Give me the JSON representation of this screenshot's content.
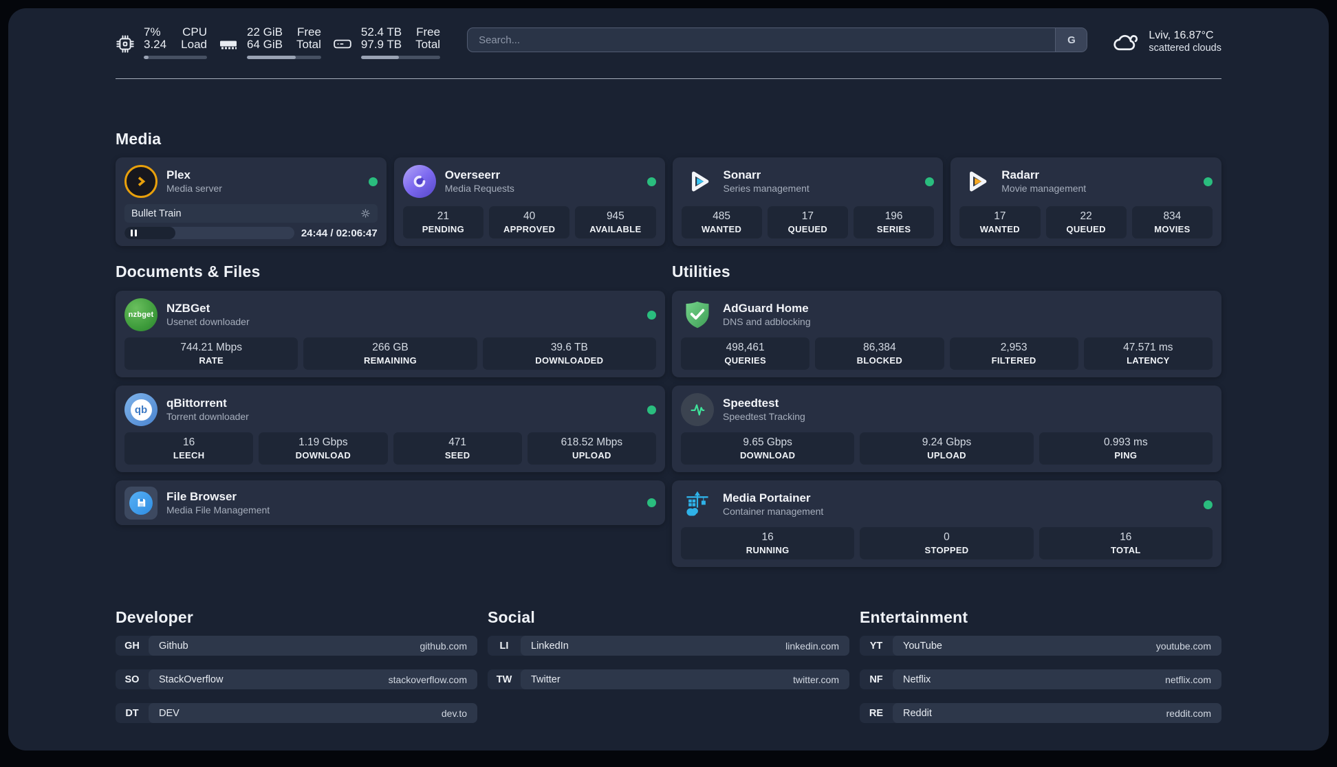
{
  "app": {
    "topbar": {
      "cpu": {
        "value_top": "7%",
        "value_bottom": "3.24",
        "label_top": "CPU",
        "label_bottom": "Load",
        "bar_percent": 8
      },
      "memory": {
        "value_top": "22 GiB",
        "value_bottom": "64 GiB",
        "label_top": "Free",
        "label_bottom": "Total",
        "bar_percent": 66
      },
      "storage": {
        "value_top": "52.4 TB",
        "value_bottom": "97.9 TB",
        "label_top": "Free",
        "label_bottom": "Total",
        "bar_percent": 48
      },
      "search": {
        "placeholder": "Search...",
        "button_label": "G"
      },
      "weather": {
        "location": "Lviv, 16.87°C",
        "condition": "scattered clouds"
      }
    },
    "sections": {
      "media": {
        "title": "Media",
        "apps": [
          {
            "name": "Plex",
            "description": "Media server",
            "online": true,
            "icon": "plex-icon",
            "player": {
              "title": "Bullet Train",
              "time": "24:44 / 02:06:47",
              "progress_percent": 30
            }
          },
          {
            "name": "Overseerr",
            "description": "Media Requests",
            "online": true,
            "icon": "overseerr-icon",
            "stats": [
              {
                "value": "21",
                "label": "PENDING"
              },
              {
                "value": "40",
                "label": "APPROVED"
              },
              {
                "value": "945",
                "label": "AVAILABLE"
              }
            ]
          },
          {
            "name": "Sonarr",
            "description": "Series management",
            "online": true,
            "icon": "sonarr-icon",
            "stats": [
              {
                "value": "485",
                "label": "WANTED"
              },
              {
                "value": "17",
                "label": "QUEUED"
              },
              {
                "value": "196",
                "label": "SERIES"
              }
            ]
          },
          {
            "name": "Radarr",
            "description": "Movie management",
            "online": true,
            "icon": "radarr-icon",
            "stats": [
              {
                "value": "17",
                "label": "WANTED"
              },
              {
                "value": "22",
                "label": "QUEUED"
              },
              {
                "value": "834",
                "label": "MOVIES"
              }
            ]
          }
        ]
      },
      "documents": {
        "title": "Documents & Files",
        "apps": [
          {
            "name": "NZBGet",
            "description": "Usenet downloader",
            "online": true,
            "icon": "nzbget-icon",
            "icon_text": "nzbget",
            "stats": [
              {
                "value": "744.21 Mbps",
                "label": "RATE"
              },
              {
                "value": "266 GB",
                "label": "REMAINING"
              },
              {
                "value": "39.6 TB",
                "label": "DOWNLOADED"
              }
            ]
          },
          {
            "name": "qBittorrent",
            "description": "Torrent downloader",
            "online": true,
            "icon": "qbittorrent-icon",
            "icon_text": "qb",
            "stats": [
              {
                "value": "16",
                "label": "LEECH"
              },
              {
                "value": "1.19 Gbps",
                "label": "DOWNLOAD"
              },
              {
                "value": "471",
                "label": "SEED"
              },
              {
                "value": "618.52 Mbps",
                "label": "UPLOAD"
              }
            ]
          },
          {
            "name": "File Browser",
            "description": "Media File Management",
            "online": true,
            "icon": "filebrowser-icon"
          }
        ]
      },
      "utilities": {
        "title": "Utilities",
        "apps": [
          {
            "name": "AdGuard Home",
            "description": "DNS and adblocking",
            "online": false,
            "icon": "adguard-icon",
            "stats": [
              {
                "value": "498,461",
                "label": "QUERIES"
              },
              {
                "value": "86,384",
                "label": "BLOCKED"
              },
              {
                "value": "2,953",
                "label": "FILTERED"
              },
              {
                "value": "47.571 ms",
                "label": "LATENCY"
              }
            ]
          },
          {
            "name": "Speedtest",
            "description": "Speedtest Tracking",
            "online": false,
            "icon": "speedtest-icon",
            "stats": [
              {
                "value": "9.65 Gbps",
                "label": "DOWNLOAD"
              },
              {
                "value": "9.24 Gbps",
                "label": "UPLOAD"
              },
              {
                "value": "0.993 ms",
                "label": "PING"
              }
            ]
          },
          {
            "name": "Media Portainer",
            "description": "Container management",
            "online": true,
            "icon": "portainer-icon",
            "stats": [
              {
                "value": "16",
                "label": "RUNNING"
              },
              {
                "value": "0",
                "label": "STOPPED"
              },
              {
                "value": "16",
                "label": "TOTAL"
              }
            ]
          }
        ]
      },
      "links": [
        {
          "title": "Developer",
          "items": [
            {
              "tag": "GH",
              "name": "Github",
              "url": "github.com"
            },
            {
              "tag": "SO",
              "name": "StackOverflow",
              "url": "stackoverflow.com"
            },
            {
              "tag": "DT",
              "name": "DEV",
              "url": "dev.to"
            }
          ]
        },
        {
          "title": "Social",
          "items": [
            {
              "tag": "LI",
              "name": "LinkedIn",
              "url": "linkedin.com"
            },
            {
              "tag": "TW",
              "name": "Twitter",
              "url": "twitter.com"
            }
          ]
        },
        {
          "title": "Entertainment",
          "items": [
            {
              "tag": "YT",
              "name": "YouTube",
              "url": "youtube.com"
            },
            {
              "tag": "NF",
              "name": "Netflix",
              "url": "netflix.com"
            },
            {
              "tag": "RE",
              "name": "Reddit",
              "url": "reddit.com"
            }
          ]
        }
      ]
    },
    "colors": {
      "background": "#1a2232",
      "card": "#272f42",
      "stat_pill": "#1e2636",
      "status_online": "#2abd7e",
      "plex_amber": "#e8a00c",
      "sonarr_blue": "#38c6f4",
      "radarr_orange": "#f7a823",
      "adguard_green": "#57bd6d",
      "portainer_blue": "#2fb2e8",
      "qbittorrent_blue": "#4a84cf",
      "nzbget_green": "#3c9a3a",
      "overseerr_purple": "#7e6bf0",
      "speedtest_green": "#3fe39a"
    }
  }
}
